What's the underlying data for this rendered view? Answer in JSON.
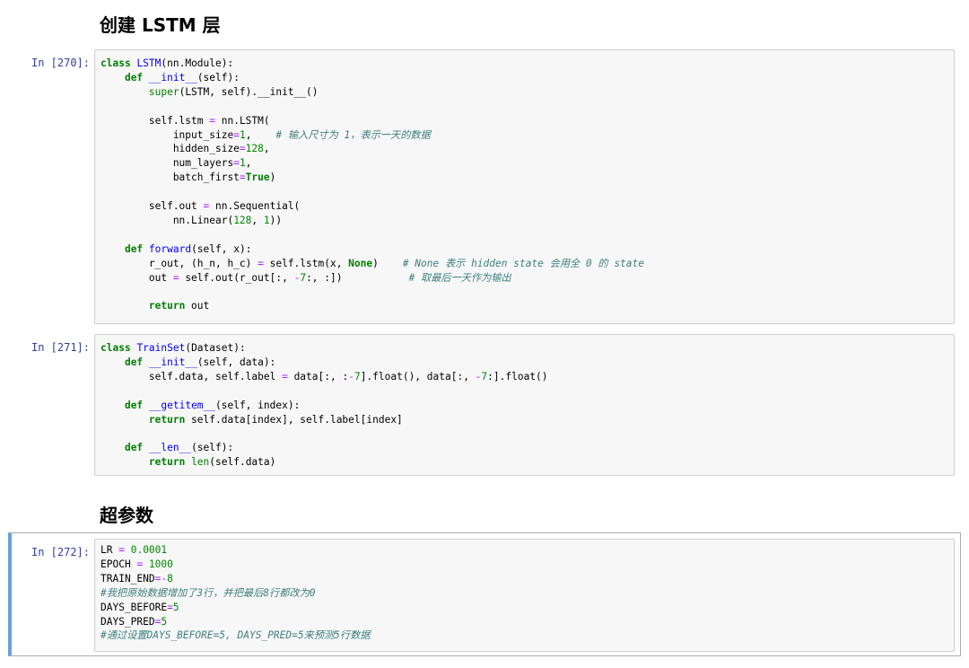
{
  "headings": {
    "lstm": "创建 LSTM 层",
    "hyper": "超参数"
  },
  "cells": [
    {
      "prompt": "In [270]:",
      "lines": [
        [
          [
            "kw",
            "class"
          ],
          [
            "t",
            " "
          ],
          [
            "def",
            "LSTM"
          ],
          [
            "t",
            "(nn.Module):"
          ]
        ],
        [
          [
            "t",
            "    "
          ],
          [
            "kw",
            "def"
          ],
          [
            "t",
            " "
          ],
          [
            "def",
            "__init__"
          ],
          [
            "t",
            "(self):"
          ]
        ],
        [
          [
            "t",
            "        "
          ],
          [
            "bi",
            "super"
          ],
          [
            "t",
            "(LSTM, self).__init__()"
          ]
        ],
        [
          [
            "t",
            ""
          ]
        ],
        [
          [
            "t",
            "        self.lstm "
          ],
          [
            "op",
            "="
          ],
          [
            "t",
            " nn.LSTM("
          ]
        ],
        [
          [
            "t",
            "            input_size"
          ],
          [
            "op",
            "="
          ],
          [
            "num",
            "1"
          ],
          [
            "t",
            ",    "
          ],
          [
            "cm",
            "# 输入尺寸为 1，表示一天的数据"
          ]
        ],
        [
          [
            "t",
            "            hidden_size"
          ],
          [
            "op",
            "="
          ],
          [
            "num",
            "128"
          ],
          [
            "t",
            ","
          ]
        ],
        [
          [
            "t",
            "            num_layers"
          ],
          [
            "op",
            "="
          ],
          [
            "num",
            "1"
          ],
          [
            "t",
            ","
          ]
        ],
        [
          [
            "t",
            "            batch_first"
          ],
          [
            "op",
            "="
          ],
          [
            "kw",
            "True"
          ],
          [
            "t",
            ")"
          ]
        ],
        [
          [
            "t",
            ""
          ]
        ],
        [
          [
            "t",
            "        self.out "
          ],
          [
            "op",
            "="
          ],
          [
            "t",
            " nn.Sequential("
          ]
        ],
        [
          [
            "t",
            "            nn.Linear("
          ],
          [
            "num",
            "128"
          ],
          [
            "t",
            ", "
          ],
          [
            "num",
            "1"
          ],
          [
            "t",
            "))"
          ]
        ],
        [
          [
            "t",
            ""
          ]
        ],
        [
          [
            "t",
            "    "
          ],
          [
            "kw",
            "def"
          ],
          [
            "t",
            " "
          ],
          [
            "def",
            "forward"
          ],
          [
            "t",
            "(self, x):"
          ]
        ],
        [
          [
            "t",
            "        r_out, (h_n, h_c) "
          ],
          [
            "op",
            "="
          ],
          [
            "t",
            " self.lstm(x, "
          ],
          [
            "kw",
            "None"
          ],
          [
            "t",
            ")    "
          ],
          [
            "cm",
            "# None 表示 hidden state 会用全 0 的 state"
          ]
        ],
        [
          [
            "t",
            "        out "
          ],
          [
            "op",
            "="
          ],
          [
            "t",
            " self.out(r_out[:, "
          ],
          [
            "op",
            "-"
          ],
          [
            "num",
            "7"
          ],
          [
            "t",
            ":, :])           "
          ],
          [
            "cm",
            "# 取最后一天作为输出"
          ]
        ],
        [
          [
            "t",
            ""
          ]
        ],
        [
          [
            "t",
            "        "
          ],
          [
            "kw",
            "return"
          ],
          [
            "t",
            " out"
          ]
        ]
      ]
    },
    {
      "prompt": "In [271]:",
      "lines": [
        [
          [
            "kw",
            "class"
          ],
          [
            "t",
            " "
          ],
          [
            "def",
            "TrainSet"
          ],
          [
            "t",
            "(Dataset):"
          ]
        ],
        [
          [
            "t",
            "    "
          ],
          [
            "kw",
            "def"
          ],
          [
            "t",
            " "
          ],
          [
            "def",
            "__init__"
          ],
          [
            "t",
            "(self, data):"
          ]
        ],
        [
          [
            "t",
            "        self.data, self.label "
          ],
          [
            "op",
            "="
          ],
          [
            "t",
            " data[:, :"
          ],
          [
            "op",
            "-"
          ],
          [
            "num",
            "7"
          ],
          [
            "t",
            "].float(), data[:, "
          ],
          [
            "op",
            "-"
          ],
          [
            "num",
            "7"
          ],
          [
            "t",
            ":].float()"
          ]
        ],
        [
          [
            "t",
            ""
          ]
        ],
        [
          [
            "t",
            "    "
          ],
          [
            "kw",
            "def"
          ],
          [
            "t",
            " "
          ],
          [
            "def",
            "__getitem__"
          ],
          [
            "t",
            "(self, index):"
          ]
        ],
        [
          [
            "t",
            "        "
          ],
          [
            "kw",
            "return"
          ],
          [
            "t",
            " self.data[index], self.label[index]"
          ]
        ],
        [
          [
            "t",
            ""
          ]
        ],
        [
          [
            "t",
            "    "
          ],
          [
            "kw",
            "def"
          ],
          [
            "t",
            " "
          ],
          [
            "def",
            "__len__"
          ],
          [
            "t",
            "(self):"
          ]
        ],
        [
          [
            "t",
            "        "
          ],
          [
            "kw",
            "return"
          ],
          [
            "t",
            " "
          ],
          [
            "bi",
            "len"
          ],
          [
            "t",
            "(self.data)"
          ]
        ]
      ]
    },
    {
      "prompt": "In [272]:",
      "lines": [
        [
          [
            "t",
            "LR "
          ],
          [
            "op",
            "="
          ],
          [
            "t",
            " "
          ],
          [
            "num",
            "0.0001"
          ]
        ],
        [
          [
            "t",
            "EPOCH "
          ],
          [
            "op",
            "="
          ],
          [
            "t",
            " "
          ],
          [
            "num",
            "1000"
          ]
        ],
        [
          [
            "t",
            "TRAIN_END"
          ],
          [
            "op",
            "=-"
          ],
          [
            "num",
            "8"
          ]
        ],
        [
          [
            "cm",
            "#我把原始数据增加了3行，并把最后8行都改为0"
          ]
        ],
        [
          [
            "t",
            "DAYS_BEFORE"
          ],
          [
            "op",
            "="
          ],
          [
            "num",
            "5"
          ]
        ],
        [
          [
            "t",
            "DAYS_PRED"
          ],
          [
            "op",
            "="
          ],
          [
            "num",
            "5"
          ]
        ],
        [
          [
            "cm",
            "#通过设置DAYS_BEFORE=5, DAYS_PRED=5来预测5行数据"
          ]
        ]
      ]
    }
  ]
}
